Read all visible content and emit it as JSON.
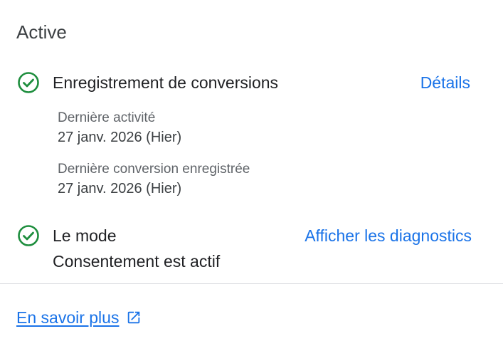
{
  "section": {
    "title": "Active"
  },
  "items": [
    {
      "icon": "check-circle-icon",
      "title": "Enregistrement de conversions",
      "action_label": "Détails",
      "details": [
        {
          "label": "Dernière activité",
          "value": "27 janv. 2026 (Hier)"
        },
        {
          "label": "Dernière conversion enregistrée",
          "value": "27 janv. 2026 (Hier)"
        }
      ]
    },
    {
      "icon": "check-circle-icon",
      "title_line1": "Le mode",
      "title_line2": "Consentement est actif",
      "action_label": "Afficher les diagnostics"
    }
  ],
  "footer": {
    "learn_more_label": "En savoir plus",
    "learn_more_icon": "external-link-icon"
  },
  "colors": {
    "success": "#1e8e3e",
    "link": "#1a73e8",
    "text_primary": "#202124",
    "text_secondary": "#5f6368",
    "divider": "#dadce0"
  }
}
